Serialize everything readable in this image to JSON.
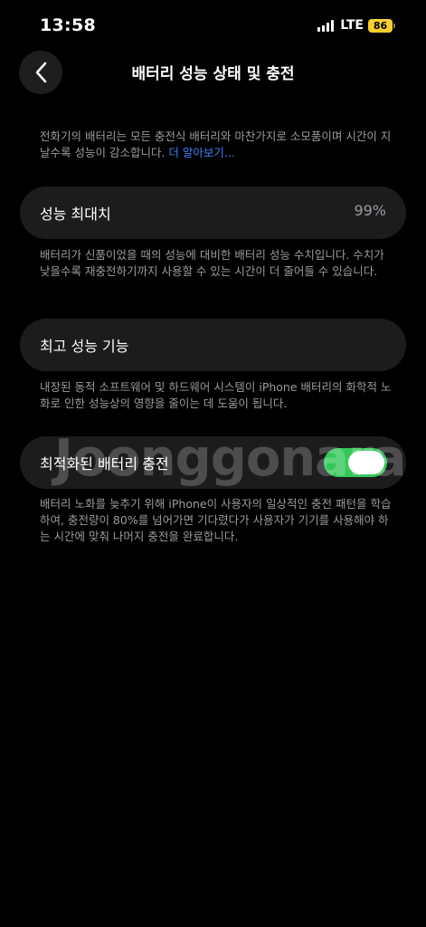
{
  "status_bar": {
    "time": "13:58",
    "network": "LTE",
    "battery_level": "86",
    "battery_color": "#f7d02e"
  },
  "nav": {
    "back_icon": "chevron-left-icon",
    "title": "배터리 성능 상태 및 충전"
  },
  "intro": {
    "text": "전화기의 배터리는 모든 충전식 배터리와 마찬가지로 소모품이며 시간이 지날수록 성능이 감소합니다. ",
    "link": "더 알아보기..."
  },
  "max_capacity": {
    "label": "성능 최대치",
    "value": "99%",
    "description": "배터리가 신품이었을 때의 성능에 대비한 배터리 성능 수치입니다. 수치가 낮을수록 재충전하기까지 사용할 수 있는 시간이 더 줄어들 수 있습니다."
  },
  "peak_performance": {
    "label": "최고 성능 기능",
    "description": "내장된 동적 소프트웨어 및 하드웨어 시스템이 iPhone 배터리의 화학적 노화로 인한 성능상의 영향을 줄이는 데 도움이 됩니다."
  },
  "optimized_charging": {
    "label": "최적화된 배터리 충전",
    "enabled": true,
    "toggle_color": "#34c759",
    "description": "배터리 노화를 늦추기 위해 iPhone이 사용자의 일상적인 충전 패턴을 학습하여, 충전량이 80%를 넘어가면 기다렸다가 사용자가 기기를 사용해야 하는 시간에 맞춰 나머지 충전을 완료합니다."
  },
  "watermark": "Joonggonara"
}
